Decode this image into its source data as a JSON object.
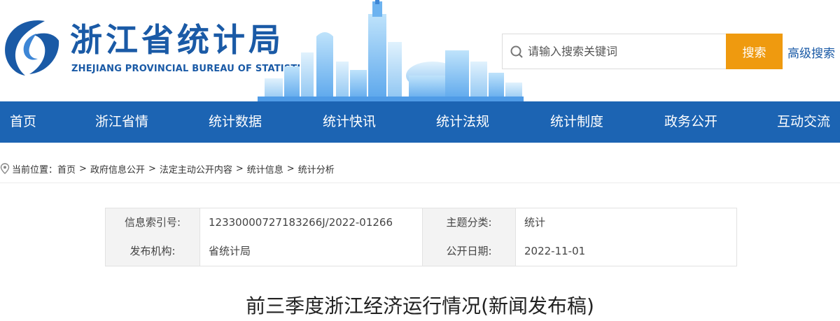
{
  "header": {
    "logo_cn": "浙江省统计局",
    "logo_en": "ZHEJIANG PROVINCIAL BUREAU OF STATISTICS"
  },
  "search": {
    "placeholder": "请输入搜索关键词",
    "button": "搜索",
    "advanced": "高级搜索"
  },
  "nav": {
    "items": [
      "首页",
      "浙江省情",
      "统计数据",
      "统计快讯",
      "统计法规",
      "统计制度",
      "政务公开",
      "互动交流"
    ]
  },
  "breadcrumb": {
    "prefix": "当前位置：",
    "items": [
      "首页",
      "政府信息公开",
      "法定主动公开内容",
      "统计信息",
      "统计分析"
    ],
    "separator": ">"
  },
  "info": {
    "index_label": "信息索引号:",
    "index_value": "12330000727183266J/2022-01266",
    "topic_label": "主题分类:",
    "topic_value": "统计",
    "org_label": "发布机构:",
    "org_value": "省统计局",
    "date_label": "公开日期:",
    "date_value": "2022-11-01"
  },
  "article": {
    "title": "前三季度浙江经济运行情况(新闻发布稿)"
  },
  "colors": {
    "brand_blue": "#1c64b3",
    "accent_orange": "#ef9a0f"
  }
}
